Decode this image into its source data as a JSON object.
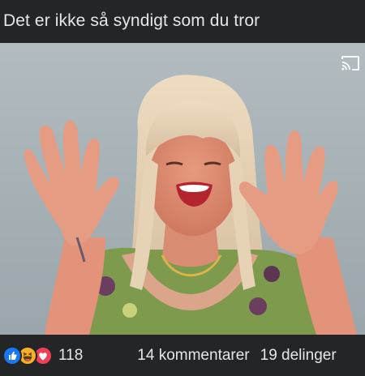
{
  "post": {
    "title": "Det er ikke så syndigt som du tror"
  },
  "video": {
    "cast_icon": "cast-icon"
  },
  "footer": {
    "reaction_icons": [
      "like-icon",
      "haha-icon",
      "love-icon"
    ],
    "reaction_count": "118",
    "comments_label": "14 kommentarer",
    "shares_label": "19 delinger"
  },
  "colors": {
    "background": "#242526",
    "text": "#e4e6eb",
    "like": "#1877f2",
    "haha": "#f7b125",
    "love": "#f33e58"
  }
}
